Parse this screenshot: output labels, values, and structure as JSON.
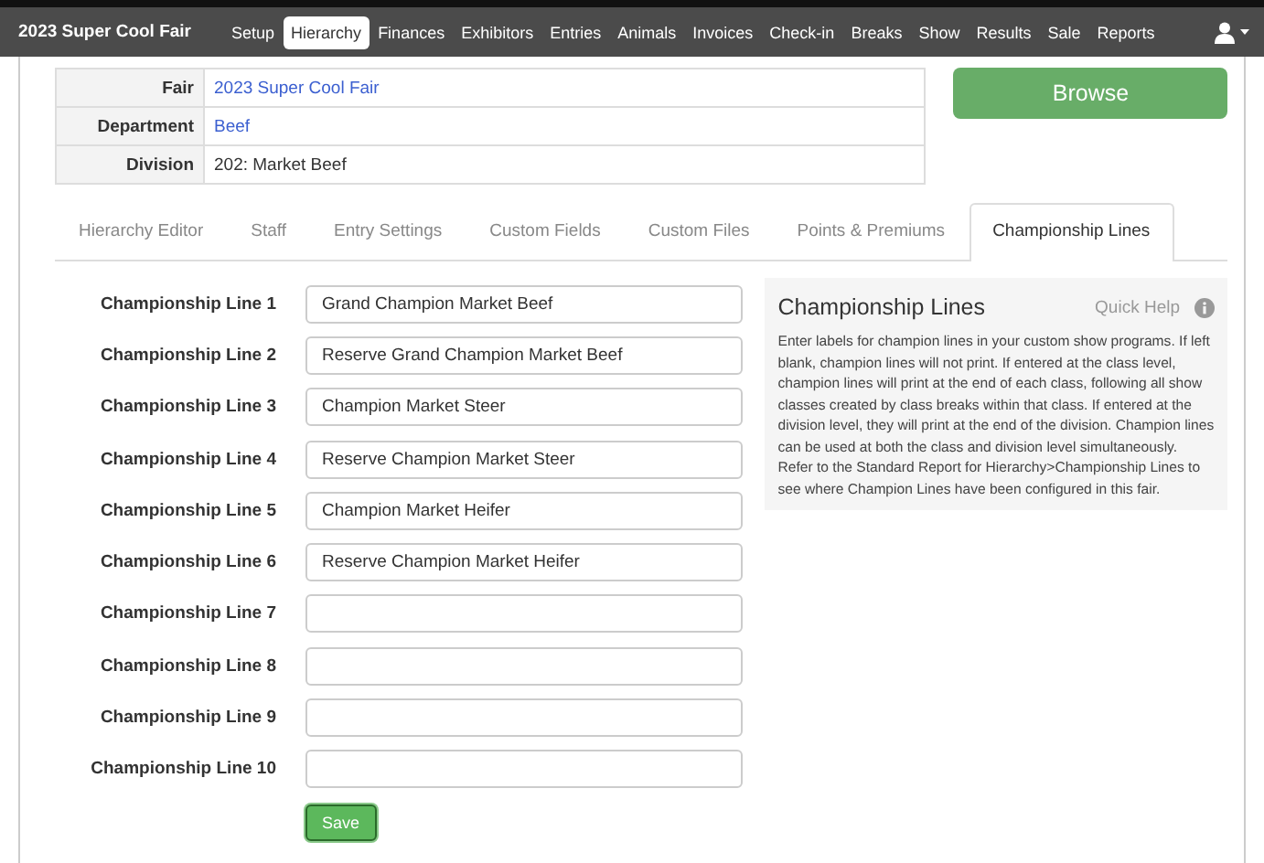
{
  "nav": {
    "brand": "2023 Super Cool Fair",
    "items": [
      {
        "label": "Setup",
        "selected": false
      },
      {
        "label": "Hierarchy",
        "selected": true
      },
      {
        "label": "Finances",
        "selected": false
      },
      {
        "label": "Exhibitors",
        "selected": false
      },
      {
        "label": "Entries",
        "selected": false
      },
      {
        "label": "Animals",
        "selected": false
      },
      {
        "label": "Invoices",
        "selected": false
      },
      {
        "label": "Check-in",
        "selected": false
      },
      {
        "label": "Breaks",
        "selected": false
      },
      {
        "label": "Show",
        "selected": false
      },
      {
        "label": "Results",
        "selected": false
      },
      {
        "label": "Sale",
        "selected": false
      },
      {
        "label": "Reports",
        "selected": false
      }
    ]
  },
  "info": [
    {
      "label": "Fair",
      "value": "2023 Super Cool Fair",
      "kind": "link"
    },
    {
      "label": "Department",
      "value": "Beef",
      "kind": "link"
    },
    {
      "label": "Division",
      "value": "202: Market Beef",
      "kind": "text"
    }
  ],
  "browse_button": "Browse",
  "tabs": [
    {
      "label": "Hierarchy Editor",
      "selected": false
    },
    {
      "label": "Staff",
      "selected": false
    },
    {
      "label": "Entry Settings",
      "selected": false
    },
    {
      "label": "Custom Fields",
      "selected": false
    },
    {
      "label": "Custom Files",
      "selected": false
    },
    {
      "label": "Points & Premiums",
      "selected": false
    },
    {
      "label": "Championship Lines",
      "selected": true
    }
  ],
  "fields": [
    {
      "label": "Championship Line 1",
      "value": "Grand Champion Market Beef"
    },
    {
      "label": "Championship Line 2",
      "value": "Reserve Grand Champion Market Beef"
    },
    {
      "label": "Championship Line 3",
      "value": "Champion Market Steer"
    },
    {
      "label": "Championship Line 4",
      "value": "Reserve Champion Market Steer"
    },
    {
      "label": "Championship Line 5",
      "value": "Champion Market Heifer"
    },
    {
      "label": "Championship Line 6",
      "value": "Reserve Champion Market Heifer"
    },
    {
      "label": "Championship Line 7"
    },
    {
      "label": "Championship Line 8"
    },
    {
      "label": "Championship Line 9"
    },
    {
      "label": "Championship Line 10"
    }
  ],
  "save_button": "Save",
  "help": {
    "title": "Championship Lines",
    "link": "Quick Help",
    "text": "Enter labels for champion lines in your custom show programs. If left blank, champion lines will not print. If entered at the class level, champion lines will print at the end of each class, following all show classes created by class breaks within that class. If entered at the division level, they will print at the end of the division. Champion lines can be used at both the class and division level simultaneously. Refer to the Standard Report for Hierarchy>Championship Lines to see where Champion Lines have been configured in this fair."
  }
}
